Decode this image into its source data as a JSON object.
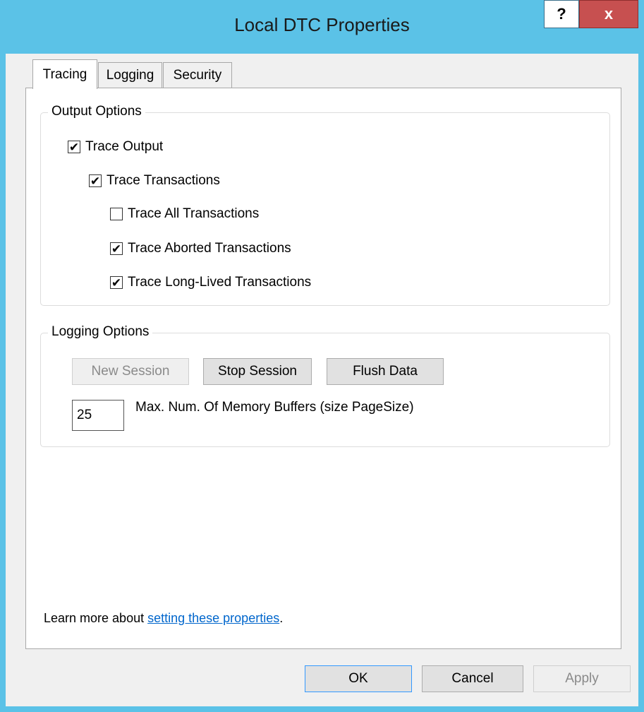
{
  "window": {
    "title": "Local DTC Properties",
    "help_label": "?",
    "close_label": "x"
  },
  "tabs": [
    {
      "label": "Tracing",
      "active": true
    },
    {
      "label": "Logging",
      "active": false
    },
    {
      "label": "Security",
      "active": false
    }
  ],
  "output_options": {
    "label": "Output Options",
    "trace_output": {
      "label": "Trace Output",
      "checked": true
    },
    "trace_transactions": {
      "label": "Trace Transactions",
      "checked": true
    },
    "trace_all": {
      "label": "Trace All Transactions",
      "checked": false
    },
    "trace_aborted": {
      "label": "Trace Aborted Transactions",
      "checked": true
    },
    "trace_long_lived": {
      "label": "Trace Long-Lived Transactions",
      "checked": true
    }
  },
  "logging_options": {
    "label": "Logging Options",
    "new_session": "New Session",
    "stop_session": "Stop Session",
    "flush_data": "Flush Data",
    "buffers_value": "25",
    "buffers_label": "Max. Num. Of Memory Buffers (size PageSize)"
  },
  "learn_more": {
    "prefix": "Learn more about ",
    "link": "setting these properties",
    "suffix": "."
  },
  "footer": {
    "ok": "OK",
    "cancel": "Cancel",
    "apply": "Apply"
  },
  "colors": {
    "titlebar": "#5bc2e7",
    "close": "#c75050",
    "link": "#0066cc"
  }
}
